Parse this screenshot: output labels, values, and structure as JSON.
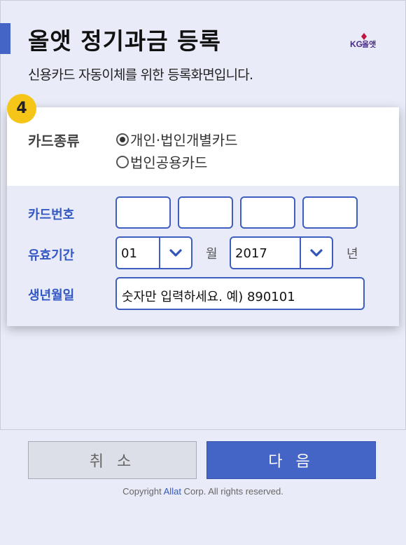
{
  "header": {
    "title": "올앳 정기과금 등록",
    "subtitle": "신용카드 자동이체를 위한 등록화면입니다.",
    "logo_kg": "KG",
    "logo_text": "올앳"
  },
  "step_number": "4",
  "card_type": {
    "label": "카드종류",
    "options": [
      {
        "label": "개인·법인개별카드",
        "selected": true
      },
      {
        "label": "법인공용카드",
        "selected": false
      }
    ]
  },
  "card_number": {
    "label": "카드번호",
    "fields": [
      "",
      "",
      "",
      ""
    ]
  },
  "expiry": {
    "label": "유효기간",
    "month": "01",
    "month_unit": "월",
    "year": "2017",
    "year_unit": "년"
  },
  "birth": {
    "label": "생년월일",
    "placeholder": "숫자만 입력하세요. 예) 890101"
  },
  "buttons": {
    "cancel": "취 소",
    "next": "다 음"
  },
  "footer": {
    "copyright_prefix": "Copyright ",
    "copyright_brand": "Allat",
    "copyright_suffix": " Corp. All rights reserved."
  },
  "colors": {
    "accent": "#4465c6",
    "label_blue": "#3358c4",
    "badge_yellow": "#f5c518",
    "logo_red": "#c4123f"
  }
}
